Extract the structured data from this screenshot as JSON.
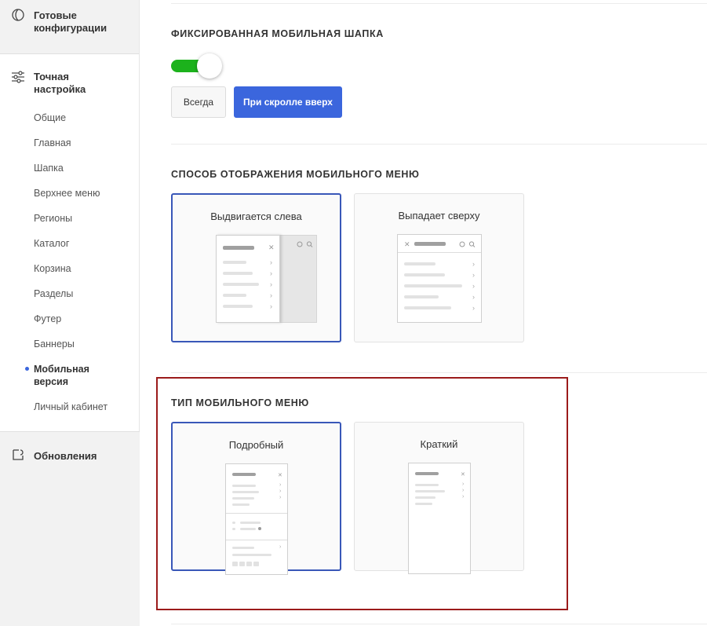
{
  "sidebar": {
    "ready_configs": "Готовые конфигурации",
    "fine_tuning": "Точная настройка",
    "items": [
      "Общие",
      "Главная",
      "Шапка",
      "Верхнее меню",
      "Регионы",
      "Каталог",
      "Корзина",
      "Разделы",
      "Футер",
      "Баннеры",
      "Мобильная версия",
      "Личный кабинет"
    ],
    "active_item": "Мобильная версия",
    "updates": "Обновления"
  },
  "sections": {
    "fixed_header": {
      "title": "ФИКСИРОВАННАЯ МОБИЛЬНАЯ ШАПКА",
      "toggle_on": true,
      "options": [
        "Всегда",
        "При скролле вверх"
      ],
      "selected": "При скролле вверх"
    },
    "menu_display": {
      "title": "СПОСОБ ОТОБРАЖЕНИЯ МОБИЛЬНОГО МЕНЮ",
      "options": [
        "Выдвигается слева",
        "Выпадает сверху"
      ],
      "selected": "Выдвигается слева"
    },
    "menu_type": {
      "title": "ТИП МОБИЛЬНОГО МЕНЮ",
      "options": [
        "Подробный",
        "Краткий"
      ],
      "selected": "Подробный"
    }
  },
  "colors": {
    "accent": "#3b66dd",
    "toggle_on": "#1cb21c",
    "highlight_border": "#9b1b1b"
  }
}
